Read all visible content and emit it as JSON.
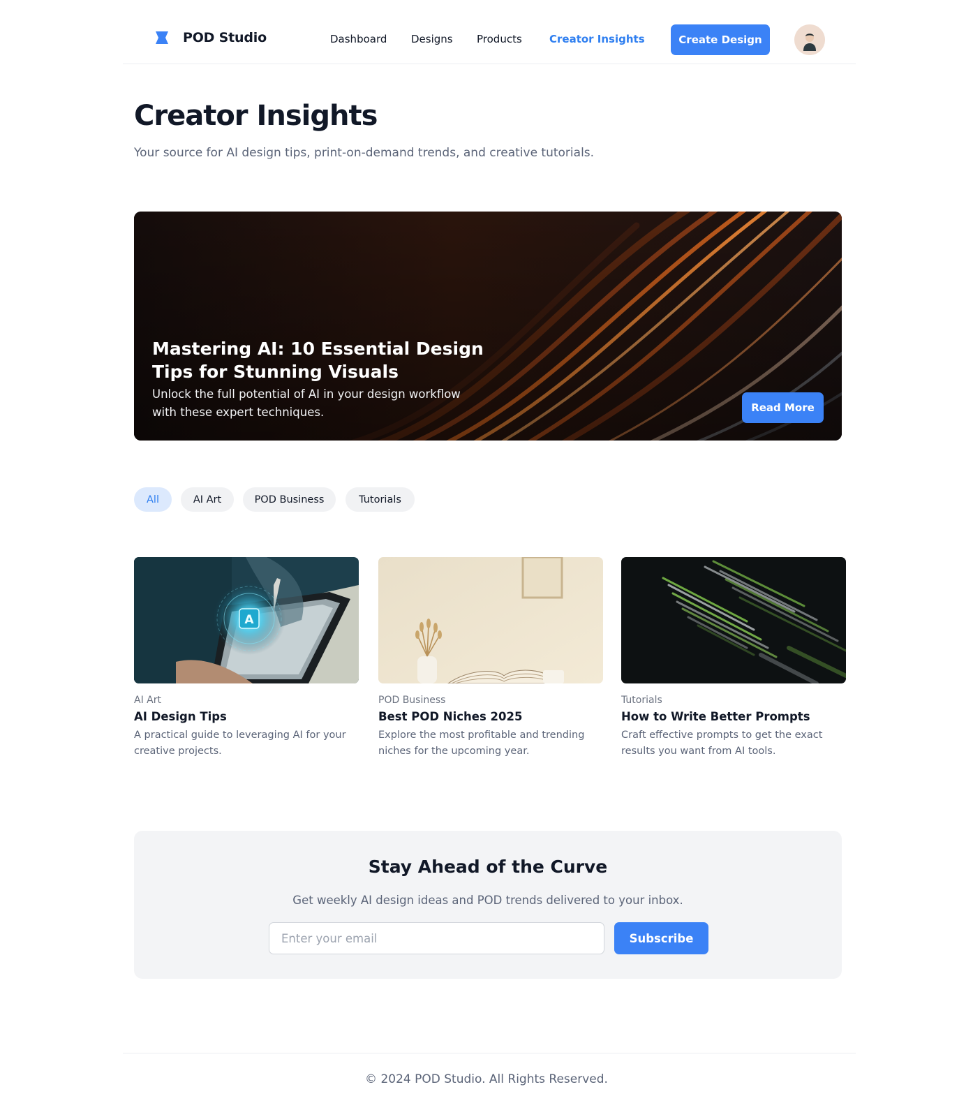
{
  "header": {
    "brand": "POD Studio",
    "nav": [
      "Dashboard",
      "Designs",
      "Products",
      "Creator Insights"
    ],
    "active_nav": "Creator Insights",
    "create_button": "Create Design"
  },
  "page": {
    "title": "Creator Insights",
    "subtitle": "Your source for AI design tips, print-on-demand trends, and creative tutorials."
  },
  "hero": {
    "title": "Mastering AI: 10 Essential Design Tips for Stunning Visuals",
    "description": "Unlock the full potential of AI in your design workflow with these expert techniques.",
    "button": "Read More"
  },
  "filters": [
    {
      "label": "All",
      "active": true
    },
    {
      "label": "AI Art",
      "active": false
    },
    {
      "label": "POD Business",
      "active": false
    },
    {
      "label": "Tutorials",
      "active": false
    }
  ],
  "articles": [
    {
      "category": "AI Art",
      "title": "AI Design Tips",
      "description": "A practical guide to leveraging AI for your creative projects."
    },
    {
      "category": "POD Business",
      "title": "Best POD Niches 2025",
      "description": "Explore the most profitable and trending niches for the upcoming year."
    },
    {
      "category": "Tutorials",
      "title": "How to Write Better Prompts",
      "description": "Craft effective prompts to get the exact results you want from AI tools."
    }
  ],
  "newsletter": {
    "title": "Stay Ahead of the Curve",
    "subtitle": "Get weekly AI design ideas and POD trends delivered to your inbox.",
    "email_placeholder": "Enter your email",
    "email_value": "",
    "subscribe_button": "Subscribe"
  },
  "footer": {
    "text": "© 2024 POD Studio. All Rights Reserved."
  },
  "colors": {
    "accent": "#3b82f6",
    "active_text": "#2f7ff0",
    "active_pill_bg": "#dce9fd",
    "muted_text": "#5b6478"
  },
  "icons": {
    "logo": "bowtie-logo-icon",
    "avatar": "user-avatar-icon"
  }
}
